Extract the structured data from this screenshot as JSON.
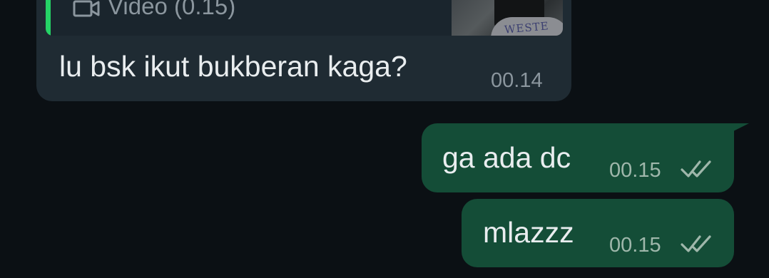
{
  "messages": {
    "incoming": {
      "reply_quote": {
        "icon": "video-camera-icon",
        "label": "Video (0.15)",
        "thumbnail_text": "WESTE"
      },
      "text": "lu bsk ikut bukberan kaga?",
      "time": "00.14"
    },
    "outgoing": [
      {
        "text": "ga ada dc",
        "time": "00.15",
        "status_icon": "double-check-icon"
      },
      {
        "text": "mlazzz",
        "time": "00.15",
        "status_icon": "double-check-icon"
      }
    ]
  },
  "colors": {
    "background": "#0b1014",
    "incoming_bubble": "#1f2b33",
    "outgoing_bubble": "#144d37",
    "quote_accent": "#25d366",
    "text": "#e9edef",
    "muted_text": "#8b969e"
  }
}
